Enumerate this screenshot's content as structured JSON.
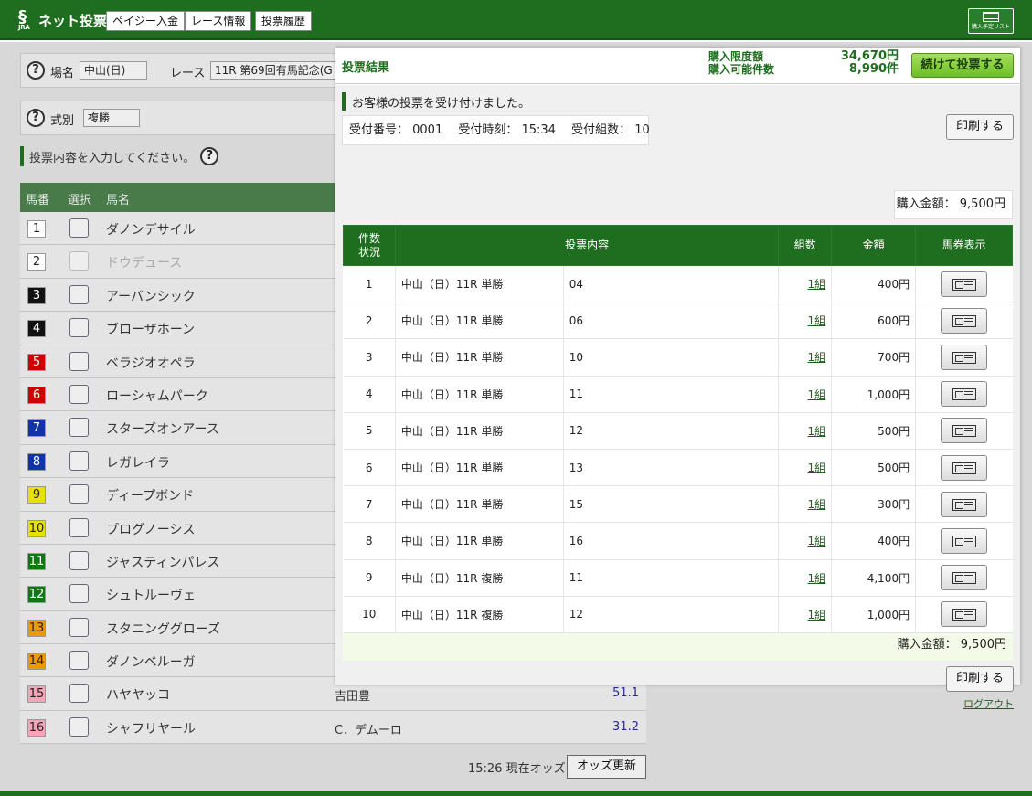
{
  "header": {
    "logo_text": "ネット投票",
    "logo_sub": "JRA",
    "nav": [
      "ペイジー入金",
      "レース情報",
      "投票履歴"
    ],
    "list_button_label": "購入予定リスト"
  },
  "background": {
    "venue_label": "場名",
    "venue_value": "中山(日)",
    "race_label": "レース",
    "race_value": "11R 第69回有馬記念(G",
    "type_label": "式別",
    "type_value": "複勝",
    "instruction": "投票内容を入力してください。",
    "help_glyph": "?",
    "columns": [
      "馬番",
      "選択",
      "馬名"
    ],
    "horses": [
      {
        "num": "1",
        "name": "ダノンデサイル",
        "jockey": "",
        "odds": "",
        "bg": "#ffffff",
        "fg": "#222",
        "disabled": false
      },
      {
        "num": "2",
        "name": "ドウデュース",
        "jockey": "",
        "odds": "",
        "bg": "#ffffff",
        "fg": "#222",
        "disabled": true
      },
      {
        "num": "3",
        "name": "アーバンシック",
        "jockey": "",
        "odds": "",
        "bg": "#111111",
        "fg": "#fff",
        "disabled": false
      },
      {
        "num": "4",
        "name": "ブローザホーン",
        "jockey": "",
        "odds": "",
        "bg": "#111111",
        "fg": "#fff",
        "disabled": false
      },
      {
        "num": "5",
        "name": "ベラジオオペラ",
        "jockey": "",
        "odds": "",
        "bg": "#cc0000",
        "fg": "#fff",
        "disabled": false
      },
      {
        "num": "6",
        "name": "ローシャムパーク",
        "jockey": "",
        "odds": "",
        "bg": "#cc0000",
        "fg": "#fff",
        "disabled": false
      },
      {
        "num": "7",
        "name": "スターズオンアース",
        "jockey": "",
        "odds": "",
        "bg": "#1133aa",
        "fg": "#fff",
        "disabled": false
      },
      {
        "num": "8",
        "name": "レガレイラ",
        "jockey": "",
        "odds": "",
        "bg": "#1133aa",
        "fg": "#fff",
        "disabled": false
      },
      {
        "num": "9",
        "name": "ディープボンド",
        "jockey": "",
        "odds": "",
        "bg": "#e8e000",
        "fg": "#222",
        "disabled": false
      },
      {
        "num": "10",
        "name": "プログノーシス",
        "jockey": "",
        "odds": "",
        "bg": "#e8e000",
        "fg": "#222",
        "disabled": false
      },
      {
        "num": "11",
        "name": "ジャスティンパレス",
        "jockey": "",
        "odds": "",
        "bg": "#117711",
        "fg": "#fff",
        "disabled": false
      },
      {
        "num": "12",
        "name": "シュトルーヴェ",
        "jockey": "",
        "odds": "",
        "bg": "#117711",
        "fg": "#fff",
        "disabled": false
      },
      {
        "num": "13",
        "name": "スタニンググローズ",
        "jockey": "",
        "odds": "",
        "bg": "#ee9900",
        "fg": "#222",
        "disabled": false
      },
      {
        "num": "14",
        "name": "ダノンベルーガ",
        "jockey": "",
        "odds": "",
        "bg": "#ee9900",
        "fg": "#222",
        "disabled": false
      },
      {
        "num": "15",
        "name": "ハヤヤッコ",
        "jockey": "吉田豊",
        "odds": "51.1",
        "bg": "#f4a6b8",
        "fg": "#222",
        "disabled": false
      },
      {
        "num": "16",
        "name": "シャフリヤール",
        "jockey": "C．デムーロ",
        "odds": "31.2",
        "bg": "#f4a6b8",
        "fg": "#222",
        "disabled": false
      }
    ],
    "odds_time": "15:26 現在オッズ",
    "odds_button": "オッズ更新"
  },
  "modal": {
    "title": "投票結果",
    "limit_label": "購入限度額",
    "limit_value": "34,670円",
    "count_label": "購入可能件数",
    "count_value": "8,990件",
    "continue_button": "続けて投票する",
    "accept_message": "お客様の投票を受け付けました。",
    "receipt_text": "受付番号： 0001　 受付時刻： 15:34　 受付組数： 10",
    "print_button": "印刷する",
    "total_text": "購入金額： 9,500円",
    "columns": {
      "count_status_1": "件数",
      "count_status_2": "状況",
      "content": "投票内容",
      "combos": "組数",
      "amount": "金額",
      "ticket": "馬券表示"
    },
    "rows": [
      {
        "no": "1",
        "race": "中山（日）11R 単勝",
        "pick": "04",
        "combos": "1組",
        "amount": "400円"
      },
      {
        "no": "2",
        "race": "中山（日）11R 単勝",
        "pick": "06",
        "combos": "1組",
        "amount": "600円"
      },
      {
        "no": "3",
        "race": "中山（日）11R 単勝",
        "pick": "10",
        "combos": "1組",
        "amount": "700円"
      },
      {
        "no": "4",
        "race": "中山（日）11R 単勝",
        "pick": "11",
        "combos": "1組",
        "amount": "1,000円"
      },
      {
        "no": "5",
        "race": "中山（日）11R 単勝",
        "pick": "12",
        "combos": "1組",
        "amount": "500円"
      },
      {
        "no": "6",
        "race": "中山（日）11R 単勝",
        "pick": "13",
        "combos": "1組",
        "amount": "500円"
      },
      {
        "no": "7",
        "race": "中山（日）11R 単勝",
        "pick": "15",
        "combos": "1組",
        "amount": "300円"
      },
      {
        "no": "8",
        "race": "中山（日）11R 単勝",
        "pick": "16",
        "combos": "1組",
        "amount": "400円"
      },
      {
        "no": "9",
        "race": "中山（日）11R 複勝",
        "pick": "11",
        "combos": "1組",
        "amount": "4,100円"
      },
      {
        "no": "10",
        "race": "中山（日）11R 複勝",
        "pick": "12",
        "combos": "1組",
        "amount": "1,000円"
      }
    ],
    "logout": "ログアウト",
    "icons": {
      "ticket": "ticket-icon",
      "list": "list-icon",
      "help": "help-icon"
    }
  }
}
